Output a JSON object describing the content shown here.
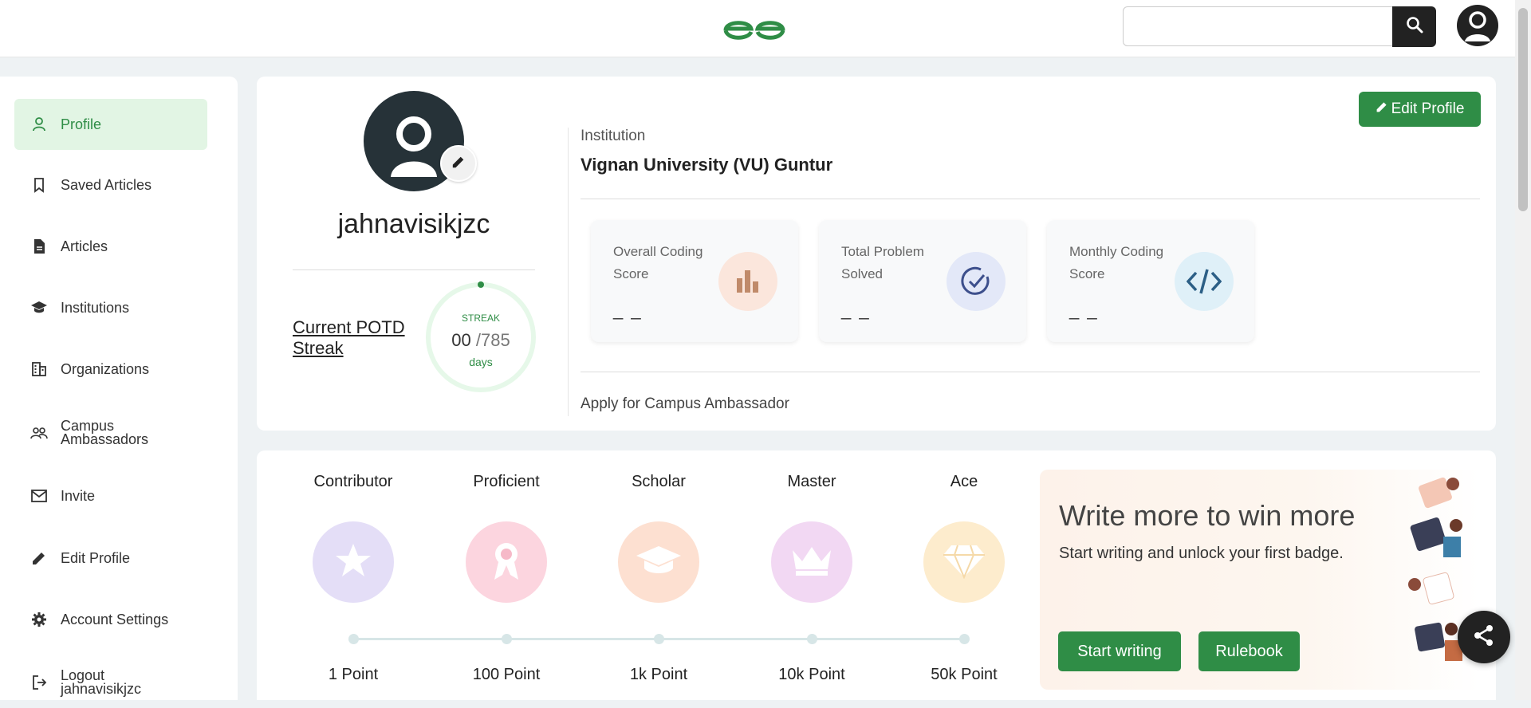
{
  "header": {
    "logo": "GfG",
    "search": {
      "value": "",
      "placeholder": ""
    },
    "icons": {
      "search": "search-icon",
      "user": "user-avatar-icon"
    }
  },
  "sidebar": {
    "items": [
      {
        "label": "Profile",
        "icon": "person-icon",
        "active": true
      },
      {
        "label": "Saved Articles",
        "icon": "bookmark-icon"
      },
      {
        "label": "Articles",
        "icon": "document-icon"
      },
      {
        "label": "Institutions",
        "icon": "graduation-cap-icon"
      },
      {
        "label": "Organizations",
        "icon": "building-icon"
      },
      {
        "label": "Campus Ambassadors",
        "icon": "group-icon"
      },
      {
        "label": "Invite",
        "icon": "mail-icon"
      },
      {
        "label": "Edit Profile",
        "icon": "pencil-icon"
      },
      {
        "label": "Account Settings",
        "icon": "gear-icon"
      },
      {
        "label": "Logout jahnavisikjzc",
        "icon": "logout-icon"
      }
    ]
  },
  "profile": {
    "username": "jahnavisikjzc",
    "potd_link": "Current POTD Streak",
    "streak": {
      "label": "STREAK",
      "current": "00",
      "total": "/785",
      "unit": "days"
    },
    "edit_button": "Edit Profile",
    "institution_label": "Institution",
    "institution_name": "Vignan University (VU) Guntur",
    "stats": [
      {
        "title": "Overall Coding Score",
        "value": "_ _",
        "icon": "bar-chart-icon",
        "color": "#fbe6dc"
      },
      {
        "title": "Total Problem Solved",
        "value": "_ _",
        "icon": "check-circle-icon",
        "color": "#e3e8f8"
      },
      {
        "title": "Monthly Coding Score",
        "value": "_ _",
        "icon": "code-icon",
        "color": "#dff0f8"
      }
    ],
    "apply_link": "Apply for Campus Ambassador"
  },
  "badges": {
    "levels": [
      {
        "name": "Contributor",
        "points": "1 Point",
        "icon": "star-icon",
        "color": "#e4def7"
      },
      {
        "name": "Proficient",
        "points": "100 Point",
        "icon": "ribbon-icon",
        "color": "#fcd5df"
      },
      {
        "name": "Scholar",
        "points": "1k Point",
        "icon": "graduation-cap-icon",
        "color": "#fde0d1"
      },
      {
        "name": "Master",
        "points": "10k Point",
        "icon": "crown-icon",
        "color": "#f2d8f3"
      },
      {
        "name": "Ace",
        "points": "50k Point",
        "icon": "diamond-icon",
        "color": "#fdeccd"
      }
    ]
  },
  "promo": {
    "title": "Write more to win more",
    "subtitle": "Start writing and unlock your first badge.",
    "start_button": "Start writing",
    "rulebook_button": "Rulebook"
  },
  "colors": {
    "brand": "#2f8d46",
    "dark": "#222222"
  }
}
